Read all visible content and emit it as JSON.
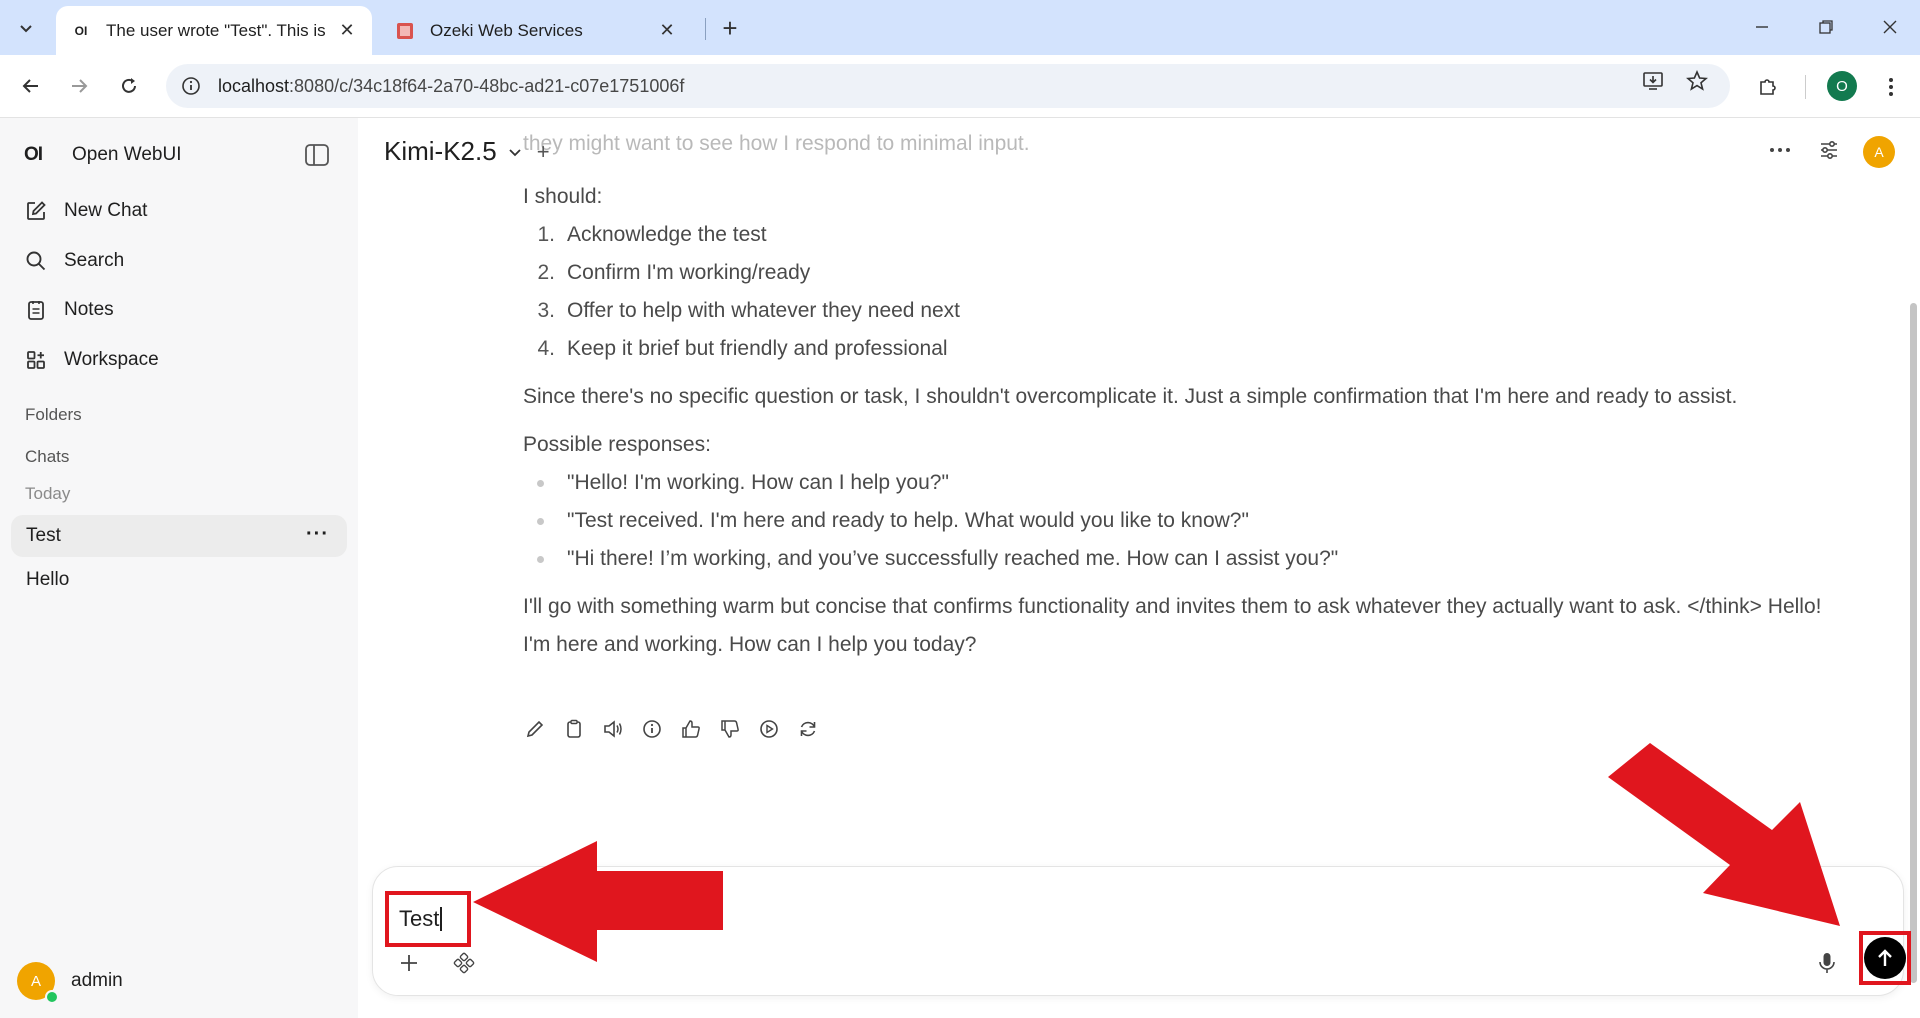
{
  "browser": {
    "tabs": [
      {
        "title": "The user wrote \"Test\". This is",
        "favicon": "OI",
        "active": true
      },
      {
        "title": "Ozeki Web Services",
        "favicon": "ozeki-icon",
        "active": false
      }
    ],
    "url_host": "localhost",
    "url_rest": ":8080/c/34c18f64-2a70-48bc-ad21-c07e1751006f",
    "profile_initial": "O"
  },
  "sidebar": {
    "brand_logo": "OI",
    "brand_name": "Open WebUI",
    "nav": [
      {
        "label": "New Chat",
        "icon": "edit-icon"
      },
      {
        "label": "Search",
        "icon": "search-icon"
      },
      {
        "label": "Notes",
        "icon": "notes-icon"
      },
      {
        "label": "Workspace",
        "icon": "workspace-icon"
      }
    ],
    "folders_label": "Folders",
    "chats_label": "Chats",
    "today_label": "Today",
    "chats": [
      {
        "title": "Test",
        "active": true
      },
      {
        "title": "Hello",
        "active": false
      }
    ],
    "user": {
      "initial": "A",
      "name": "admin"
    }
  },
  "header": {
    "model": "Kimi-K2.5",
    "avatar_initial": "A"
  },
  "message": {
    "faded_line": "they might want to see how I respond to minimal input.",
    "intro": "I should:",
    "steps": [
      "Acknowledge the test",
      "Confirm I'm working/ready",
      "Offer to help with whatever they need next",
      "Keep it brief but friendly and professional"
    ],
    "paragraph1": "Since there's no specific question or task, I shouldn't overcomplicate it. Just a simple confirmation that I'm here and ready to assist.",
    "responses_label": "Possible responses:",
    "responses": [
      "\"Hello! I'm working. How can I help you?\"",
      "\"Test received. I'm here and ready to help. What would you like to know?\"",
      "\"Hi there! I’m working, and you’ve successfully reached me. How can I assist you?\""
    ],
    "paragraph2": "I'll go with something warm but concise that confirms functionality and invites them to ask whatever they actually want to ask. </think> Hello! I'm here and working. How can I help you today?"
  },
  "composer": {
    "input_value": "Test"
  },
  "colors": {
    "annotation_red": "#e0161e",
    "avatar_orange": "#f0a400",
    "tab_strip": "#d3e3fd"
  }
}
